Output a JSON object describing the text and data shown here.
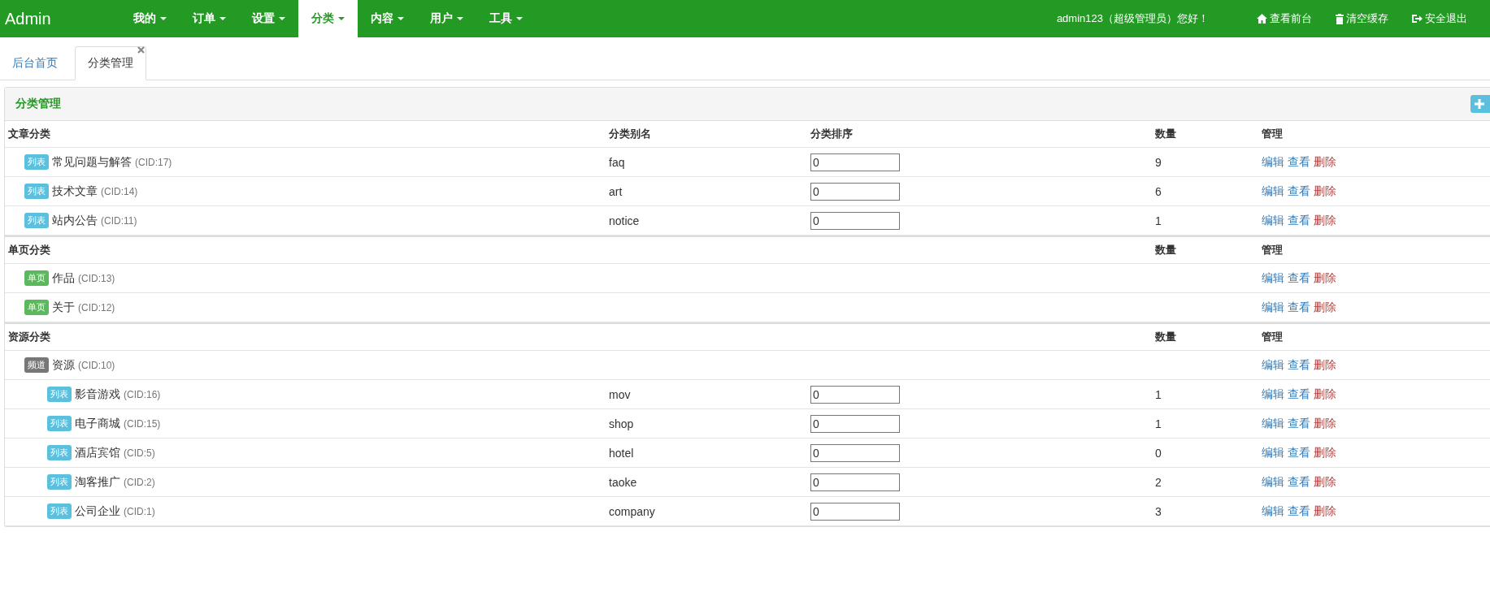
{
  "navbar": {
    "brand": "Admin",
    "menu": [
      {
        "label": "我的",
        "selected": false
      },
      {
        "label": "订单",
        "selected": false
      },
      {
        "label": "设置",
        "selected": false
      },
      {
        "label": "分类",
        "selected": true
      },
      {
        "label": "内容",
        "selected": false
      },
      {
        "label": "用户",
        "selected": false
      },
      {
        "label": "工具",
        "selected": false
      }
    ],
    "greeting": "admin123（超级管理员）您好！",
    "links": [
      {
        "kind": "home",
        "label": "查看前台"
      },
      {
        "kind": "trash",
        "label": "清空缓存"
      },
      {
        "kind": "logout",
        "label": "安全退出"
      }
    ]
  },
  "tabs": [
    {
      "label": "后台首页",
      "selected": false,
      "closable": false
    },
    {
      "label": "分类管理",
      "selected": true,
      "closable": true
    }
  ],
  "panel": {
    "title": "分类管理",
    "add_button": {
      "kind": "plus"
    },
    "groups": [
      {
        "name_heading": "文章分类",
        "alias_heading": "分类别名",
        "sort_heading": "分类排序",
        "count_heading": "数量",
        "manage_heading": "管理",
        "items": [
          {
            "kind": "list",
            "badge": "列表",
            "name": "常见问题与解答",
            "cid": "(CID:17)",
            "alias": "faq",
            "sort": "0",
            "count": "9",
            "actions": [
              {
                "kind": "edit",
                "label": "编辑"
              },
              {
                "kind": "view",
                "label": "查看"
              },
              {
                "kind": "delete",
                "label": "删除"
              }
            ]
          },
          {
            "kind": "list",
            "badge": "列表",
            "name": "技术文章",
            "cid": "(CID:14)",
            "alias": "art",
            "sort": "0",
            "count": "6",
            "actions": [
              {
                "kind": "edit",
                "label": "编辑"
              },
              {
                "kind": "view",
                "label": "查看"
              },
              {
                "kind": "delete",
                "label": "删除"
              }
            ]
          },
          {
            "kind": "list",
            "badge": "列表",
            "name": "站内公告",
            "cid": "(CID:11)",
            "alias": "notice",
            "sort": "0",
            "count": "1",
            "actions": [
              {
                "kind": "edit",
                "label": "编辑"
              },
              {
                "kind": "view",
                "label": "查看"
              },
              {
                "kind": "delete",
                "label": "删除"
              }
            ]
          }
        ]
      },
      {
        "name_heading": "单页分类",
        "count_heading": "数量",
        "manage_heading": "管理",
        "items": [
          {
            "kind": "page",
            "badge": "单页",
            "name": "作品",
            "cid": "(CID:13)",
            "actions": [
              {
                "kind": "edit",
                "label": "编辑"
              },
              {
                "kind": "view",
                "label": "查看"
              },
              {
                "kind": "delete",
                "label": "删除"
              }
            ]
          },
          {
            "kind": "page",
            "badge": "单页",
            "name": "关于",
            "cid": "(CID:12)",
            "actions": [
              {
                "kind": "edit",
                "label": "编辑"
              },
              {
                "kind": "view",
                "label": "查看"
              },
              {
                "kind": "delete",
                "label": "删除"
              }
            ]
          }
        ]
      },
      {
        "name_heading": "资源分类",
        "count_heading": "数量",
        "manage_heading": "管理",
        "items": [
          {
            "kind": "channel",
            "badge": "频道",
            "name": "资源",
            "cid": "(CID:10)",
            "actions": [
              {
                "kind": "edit",
                "label": "编辑"
              },
              {
                "kind": "view",
                "label": "查看"
              },
              {
                "kind": "delete",
                "label": "删除"
              }
            ],
            "children": [
              {
                "kind": "list",
                "badge": "列表",
                "name": "影音游戏",
                "cid": "(CID:16)",
                "alias": "mov",
                "sort": "0",
                "count": "1",
                "actions": [
                  {
                    "kind": "edit",
                    "label": "编辑"
                  },
                  {
                    "kind": "view",
                    "label": "查看"
                  },
                  {
                    "kind": "delete",
                    "label": "删除"
                  }
                ]
              },
              {
                "kind": "list",
                "badge": "列表",
                "name": "电子商城",
                "cid": "(CID:15)",
                "alias": "shop",
                "sort": "0",
                "count": "1",
                "actions": [
                  {
                    "kind": "edit",
                    "label": "编辑"
                  },
                  {
                    "kind": "view",
                    "label": "查看"
                  },
                  {
                    "kind": "delete",
                    "label": "删除"
                  }
                ]
              },
              {
                "kind": "list",
                "badge": "列表",
                "name": "酒店宾馆",
                "cid": "(CID:5)",
                "alias": "hotel",
                "sort": "0",
                "count": "0",
                "actions": [
                  {
                    "kind": "edit",
                    "label": "编辑"
                  },
                  {
                    "kind": "view",
                    "label": "查看"
                  },
                  {
                    "kind": "delete",
                    "label": "删除"
                  }
                ]
              },
              {
                "kind": "list",
                "badge": "列表",
                "name": "淘客推广",
                "cid": "(CID:2)",
                "alias": "taoke",
                "sort": "0",
                "count": "2",
                "actions": [
                  {
                    "kind": "edit",
                    "label": "编辑"
                  },
                  {
                    "kind": "view",
                    "label": "查看"
                  },
                  {
                    "kind": "delete",
                    "label": "删除"
                  }
                ]
              },
              {
                "kind": "list",
                "badge": "列表",
                "name": "公司企业",
                "cid": "(CID:1)",
                "alias": "company",
                "sort": "0",
                "count": "3",
                "actions": [
                  {
                    "kind": "edit",
                    "label": "编辑"
                  },
                  {
                    "kind": "view",
                    "label": "查看"
                  },
                  {
                    "kind": "delete",
                    "label": "删除"
                  }
                ]
              }
            ]
          }
        ]
      }
    ]
  }
}
